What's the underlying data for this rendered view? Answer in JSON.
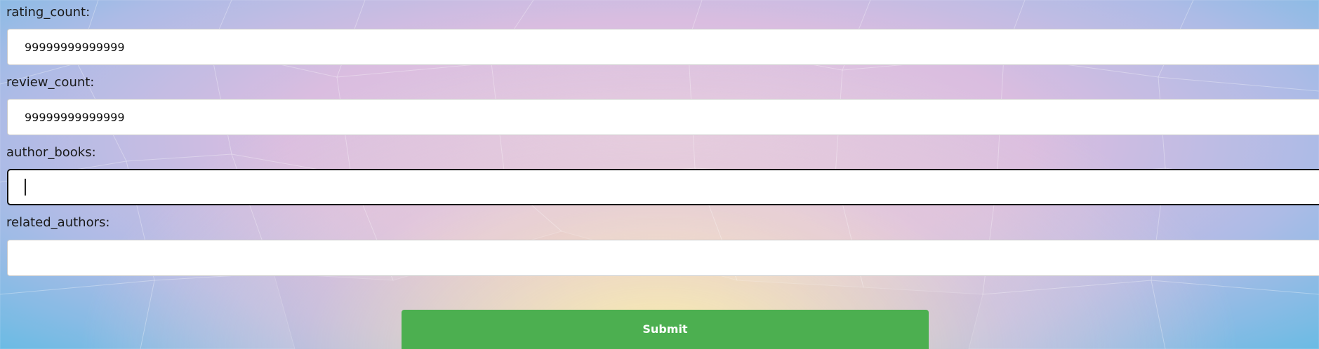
{
  "form": {
    "fields": [
      {
        "label": "rating_count:",
        "value": "99999999999999",
        "placeholder": ""
      },
      {
        "label": "review_count:",
        "value": "99999999999999",
        "placeholder": ""
      },
      {
        "label": "author_books:",
        "value": "",
        "placeholder": ""
      },
      {
        "label": "related_authors:",
        "value": "",
        "placeholder": ""
      }
    ],
    "focused_field": "author_books",
    "submit_label": "Submit"
  },
  "colors": {
    "submit_bg": "#4caf50",
    "field_bg": "#ffffff",
    "background_edge": "#5fb6e2",
    "background_center": "#fff1aa"
  }
}
